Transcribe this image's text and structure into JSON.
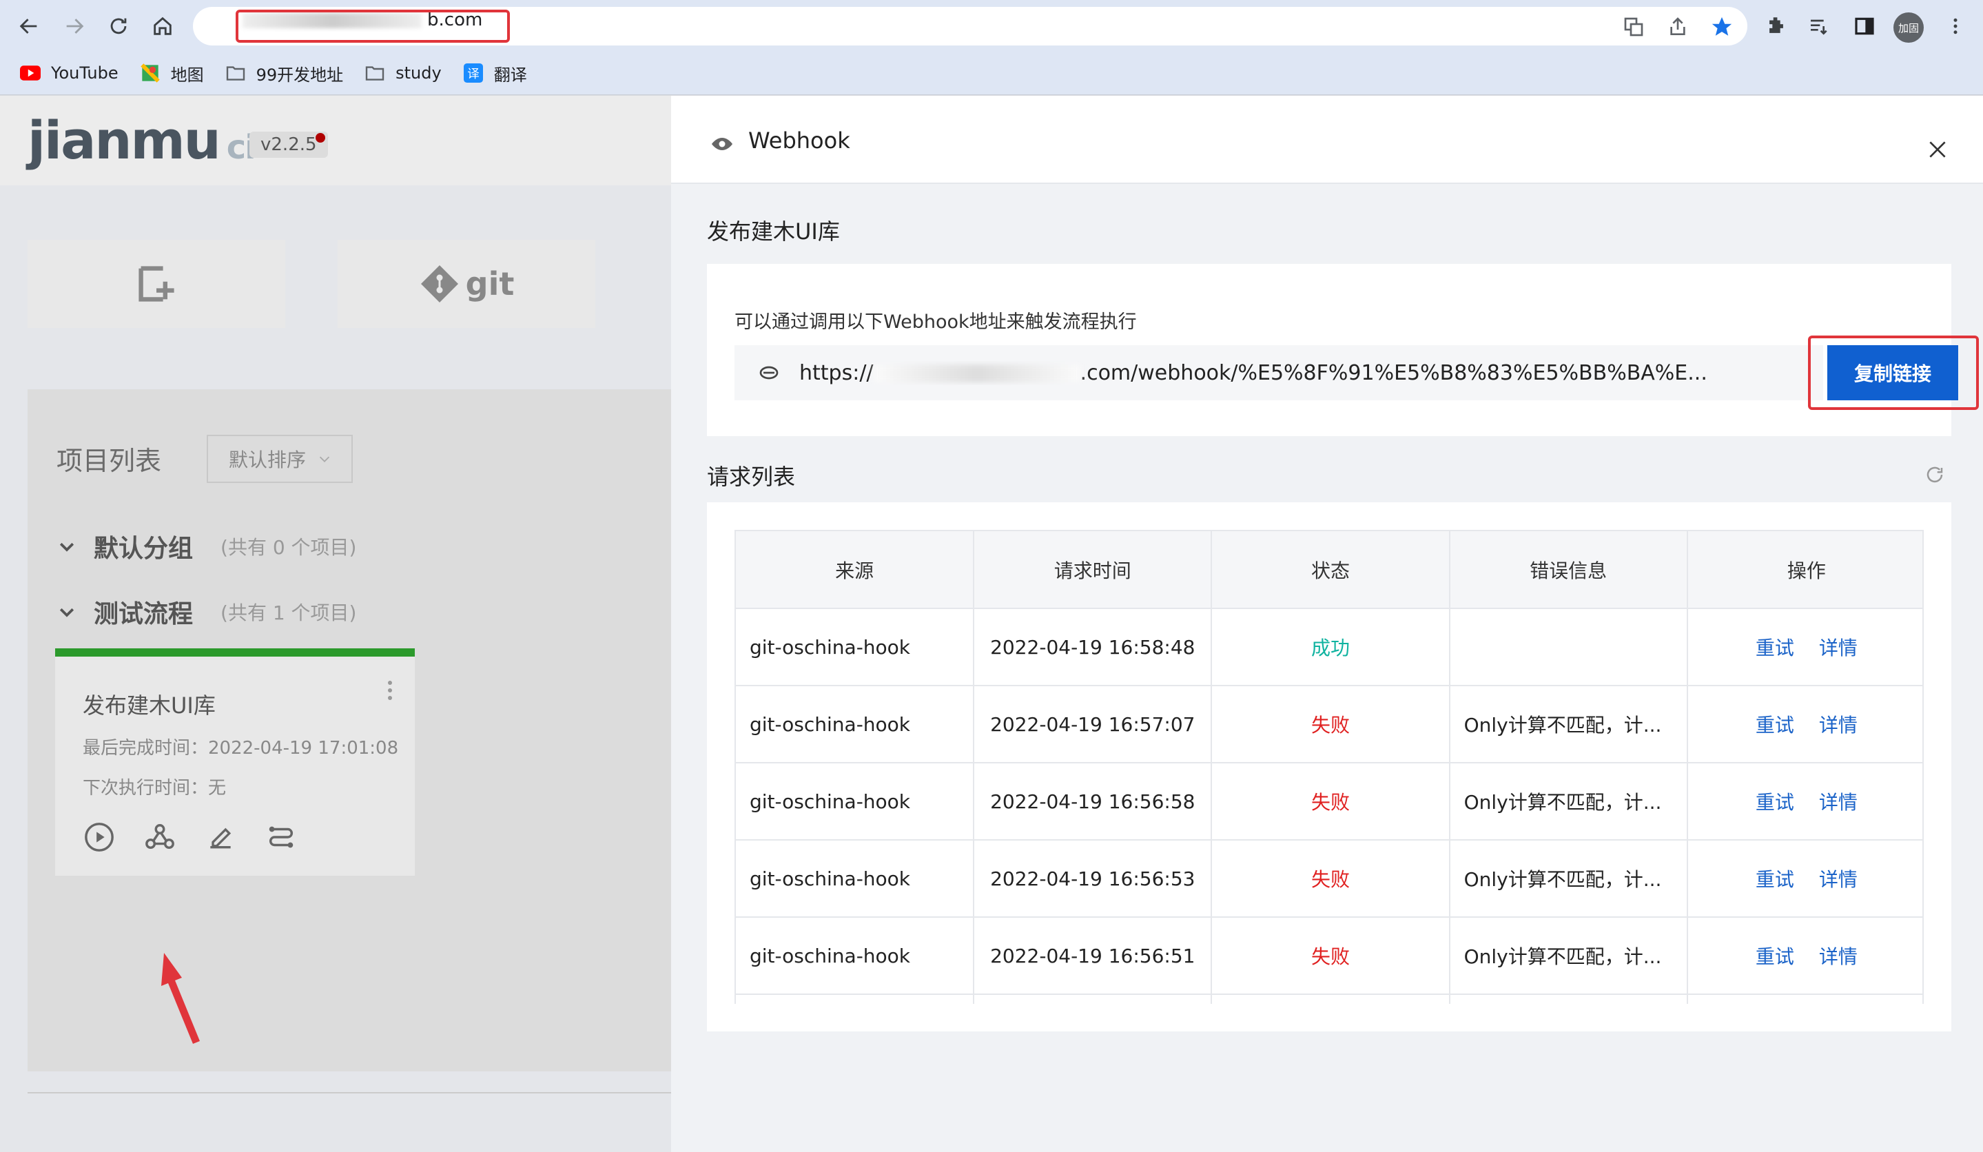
{
  "browser": {
    "url_suffix": "b.com",
    "bookmarks": [
      {
        "label": "YouTube",
        "icon": "youtube-icon"
      },
      {
        "label": "地图",
        "icon": "maps-icon"
      },
      {
        "label": "99开发地址",
        "icon": "folder-icon"
      },
      {
        "label": "study",
        "icon": "folder-icon"
      },
      {
        "label": "翻译",
        "icon": "translate-icon"
      }
    ],
    "profile_label": "加固"
  },
  "app": {
    "logo": "jianmu",
    "logo_ci": "ci",
    "version": "v2.2.5",
    "tool_git_label": "git",
    "list_title": "项目列表",
    "sort_label": "默认排序",
    "groups": [
      {
        "name": "默认分组",
        "count": "(共有 0 个项目)"
      },
      {
        "name": "测试流程",
        "count": "(共有 1 个项目)"
      }
    ],
    "project": {
      "name": "发布建木UI库",
      "last_finished": "最后完成时间：2022-04-19 17:01:08",
      "next_run": "下次执行时间：无"
    }
  },
  "drawer": {
    "title": "Webhook",
    "section_title": "发布建木UI库",
    "hint": "可以通过调用以下Webhook地址来触发流程执行",
    "url_prefix": "https://",
    "url_rest": ".com/webhook/%E5%8F%91%E5%B8%83%E5%BB%BA%E...",
    "copy_label": "复制链接",
    "requests_title": "请求列表",
    "table": {
      "headers": [
        "来源",
        "请求时间",
        "状态",
        "错误信息",
        "操作"
      ],
      "retry_label": "重试",
      "detail_label": "详情",
      "rows": [
        {
          "source": "git-oschina-hook",
          "time": "2022-04-19 16:58:48",
          "status": "成功",
          "error": ""
        },
        {
          "source": "git-oschina-hook",
          "time": "2022-04-19 16:57:07",
          "status": "失败",
          "error": "Only计算不匹配，计..."
        },
        {
          "source": "git-oschina-hook",
          "time": "2022-04-19 16:56:58",
          "status": "失败",
          "error": "Only计算不匹配，计..."
        },
        {
          "source": "git-oschina-hook",
          "time": "2022-04-19 16:56:53",
          "status": "失败",
          "error": "Only计算不匹配，计..."
        },
        {
          "source": "git-oschina-hook",
          "time": "2022-04-19 16:56:51",
          "status": "失败",
          "error": "Only计算不匹配，计..."
        }
      ]
    }
  },
  "colors": {
    "primary": "#1060d0",
    "success": "#10b3a0",
    "fail": "#e02020",
    "highlight": "#e0353b"
  }
}
